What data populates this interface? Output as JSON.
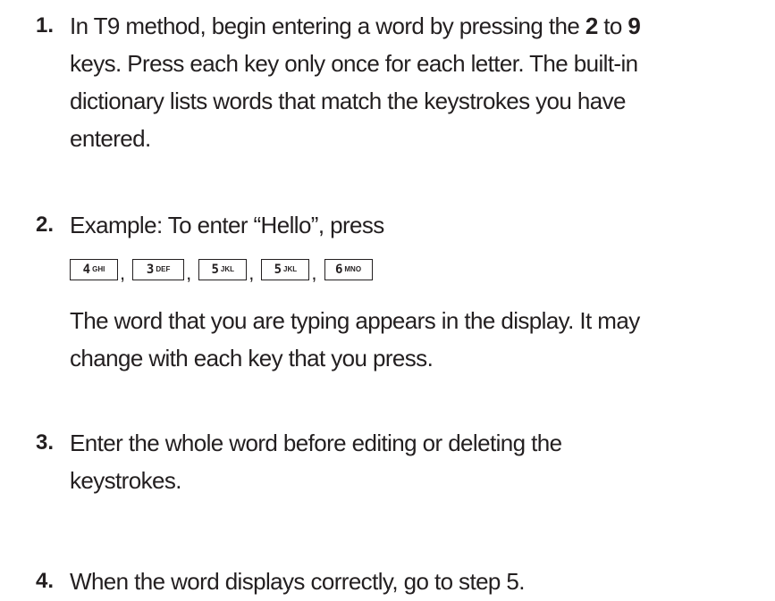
{
  "steps": [
    {
      "number": "1.",
      "lines": {
        "l1_a": "In T9 method, begin entering a word by pressing the ",
        "l1_b": "2",
        "l1_c": " to ",
        "l1_d": "9",
        "l2": "keys. Press each key only once for each letter. The built-in",
        "l3": "dictionary lists words that match the keystrokes you have",
        "l4": "entered."
      }
    },
    {
      "number": "2.",
      "intro": "Example: To enter “Hello”, press",
      "keys": [
        {
          "digit": "4",
          "letters": "GHI"
        },
        {
          "digit": "3",
          "letters": "DEF"
        },
        {
          "digit": "5",
          "letters": "JKL"
        },
        {
          "digit": "5",
          "letters": "JKL"
        },
        {
          "digit": "6",
          "letters": "MNO"
        }
      ],
      "separator": ",",
      "after_line1": "The word that you are typing appears in the display. It may",
      "after_line2": "change with each key that you press."
    },
    {
      "number": "3.",
      "line1": "Enter the whole word before editing or deleting the",
      "line2": "keystrokes."
    },
    {
      "number": "4.",
      "line1": "When the word displays correctly, go to step 5."
    }
  ]
}
